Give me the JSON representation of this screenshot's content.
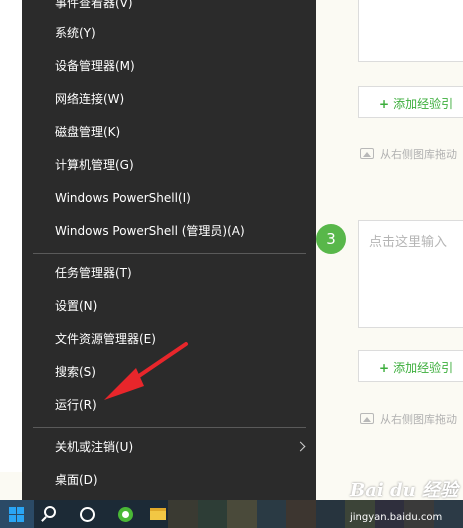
{
  "context_menu": {
    "items_top": [
      {
        "label": "事件查看器(V)"
      },
      {
        "label": "系统(Y)"
      },
      {
        "label": "设备管理器(M)"
      },
      {
        "label": "网络连接(W)"
      },
      {
        "label": "磁盘管理(K)"
      },
      {
        "label": "计算机管理(G)"
      },
      {
        "label": "Windows PowerShell(I)"
      },
      {
        "label": "Windows PowerShell (管理员)(A)"
      }
    ],
    "items_middle": [
      {
        "label": "任务管理器(T)"
      },
      {
        "label": "设置(N)"
      },
      {
        "label": "文件资源管理器(E)"
      },
      {
        "label": "搜索(S)"
      },
      {
        "label": "运行(R)"
      }
    ],
    "items_bottom": [
      {
        "label": "关机或注销(U)",
        "has_submenu": true
      },
      {
        "label": "桌面(D)"
      }
    ]
  },
  "editor": {
    "step_number": "3",
    "text_placeholder": "点击这里输入",
    "add_tip_label": "添加经验引",
    "image_tip": "从右侧图库拖动"
  },
  "watermark": {
    "logo": "Bai du 经验",
    "url": "jingyan.baidu.com"
  },
  "colors": {
    "menu_bg": "#2b2b2b",
    "menu_text": "#ffffff",
    "accent_green": "#3cae3c",
    "step_badge": "#58b74a",
    "annotation_red": "#e8262b",
    "taskbar_bg": "#1c2a36"
  },
  "icons": [
    "windows-start-icon",
    "search-icon",
    "cortana-icon",
    "app-icon",
    "file-explorer-icon",
    "chevron-right-icon",
    "image-icon"
  ]
}
